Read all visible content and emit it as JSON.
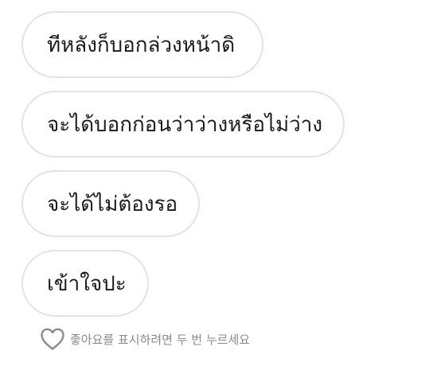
{
  "messages": [
    {
      "text": "ทีหลังก็บอกล่วงหน้าดิ"
    },
    {
      "text": "จะได้บอกก่อนว่าว่างหรือไม่ว่าง"
    },
    {
      "text": "จะได้ไม่ต้องรอ"
    },
    {
      "text": "เข้าใจปะ"
    }
  ],
  "like_hint": {
    "icon": "heart-outline-icon",
    "text": "좋아요를 표시하려면 두 번 누르세요"
  },
  "colors": {
    "bubble_border": "#e3e3e3",
    "text": "#1a1a1a",
    "hint_text": "#8a8a8a",
    "background": "#ffffff"
  }
}
